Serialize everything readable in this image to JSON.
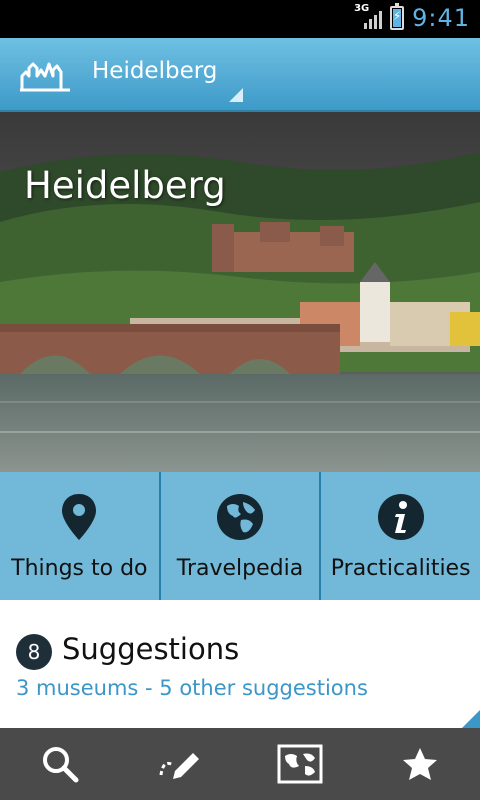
{
  "status_bar": {
    "network": "3G",
    "time": "9:41"
  },
  "action_bar": {
    "city": "Heidelberg"
  },
  "hero": {
    "title": "Heidelberg"
  },
  "categories": [
    {
      "label": "Things to do",
      "icon": "map-pin-icon"
    },
    {
      "label": "Travelpedia",
      "icon": "globe-icon"
    },
    {
      "label": "Practicalities",
      "icon": "info-icon"
    }
  ],
  "suggestions": {
    "count": "8",
    "title": "Suggestions",
    "summary": "3 museums - 5 other suggestions"
  },
  "bottom_nav": [
    {
      "icon": "search-icon"
    },
    {
      "icon": "pencil-trail-icon"
    },
    {
      "icon": "map-icon"
    },
    {
      "icon": "star-favorites-icon"
    }
  ],
  "colors": {
    "accent": "#3a97c8",
    "tile": "#72b8d8",
    "actionbar": "#4aa6d2"
  }
}
